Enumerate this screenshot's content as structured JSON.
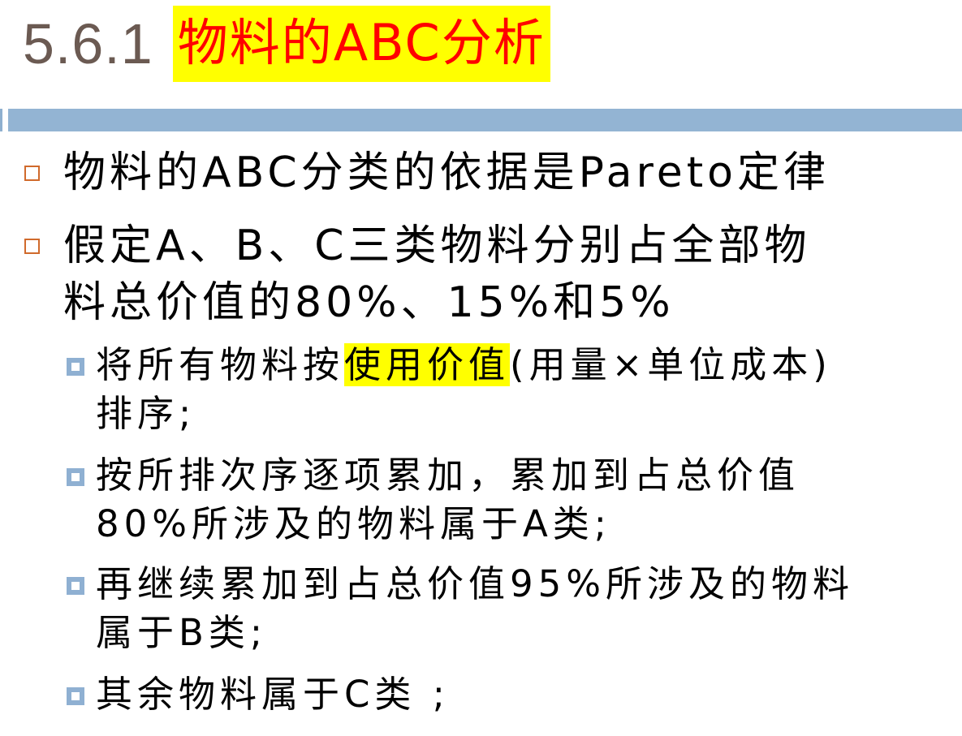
{
  "title": {
    "number": "5.6.1",
    "text": "物料的ABC分析"
  },
  "bullets": [
    {
      "line1": "物料的ABC分类的依据是Pareto定律"
    },
    {
      "line1": "假定A、B、C三类物料分别占全部物",
      "line2": "料总价值的80%、15%和5%"
    }
  ],
  "sub_bullets": [
    {
      "before": "将所有物料按",
      "highlight": "使用价值",
      "after": "(用量×单位成本)",
      "line2": "排序;"
    },
    {
      "line1": "按所排次序逐项累加，累加到占总价值",
      "line2": "80%所涉及的物料属于A类;"
    },
    {
      "line1": "再继续累加到占总价值95%所涉及的物料",
      "line2": "属于B类;"
    },
    {
      "line1": "其余物料属于C类 ;"
    }
  ],
  "colors": {
    "title_number": "#6b5a52",
    "title_text": "#ff0000",
    "highlight": "#ffff00",
    "rule_bar": "#93b4d3",
    "bullet_outline": "#d06a2c",
    "sub_bullet": "#8fb0d2"
  },
  "icons": {
    "level1_bullet": "hollow-square",
    "level2_bullet": "filled-square-with-white-center"
  }
}
